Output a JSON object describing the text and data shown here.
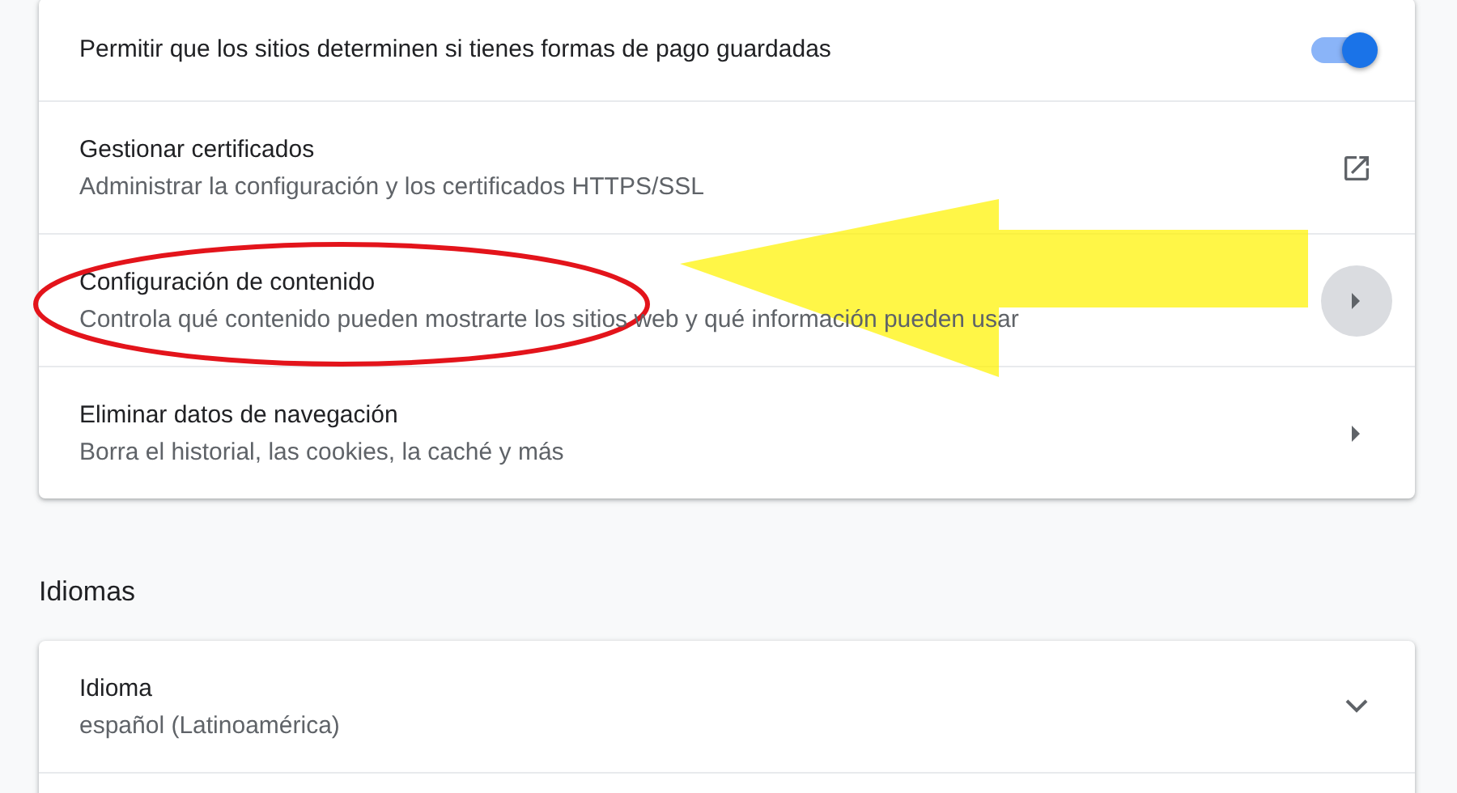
{
  "rows": [
    {
      "kind": "toggle",
      "title": "Permitir que los sitios determinen si tienes formas de pago guardadas",
      "on": true
    },
    {
      "kind": "external",
      "title": "Gestionar certificados",
      "subtitle": "Administrar la configuración y los certificados HTTPS/SSL",
      "highlighted": false
    },
    {
      "kind": "submenu",
      "title": "Configuración de contenido",
      "subtitle": "Controla qué contenido pueden mostrarte los sitios web y qué información pueden usar",
      "highlighted": true
    },
    {
      "kind": "submenu",
      "title": "Eliminar datos de navegación",
      "subtitle": "Borra el historial, las cookies, la caché y más",
      "highlighted": false
    }
  ],
  "languages": {
    "heading": "Idiomas",
    "rows": [
      {
        "kind": "dropdown",
        "title": "Idioma",
        "subtitle": "español (Latinoamérica)",
        "expanded": false
      }
    ]
  }
}
